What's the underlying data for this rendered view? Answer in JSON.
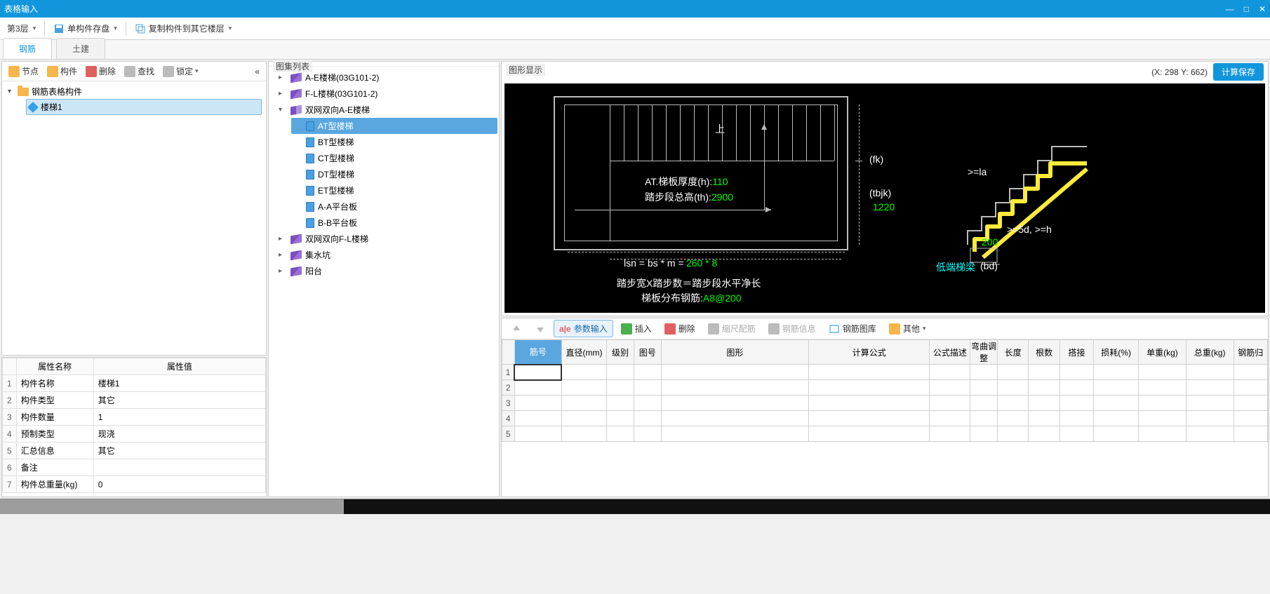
{
  "window": {
    "title": "表格输入"
  },
  "toolbar": {
    "floor_label": "第3层",
    "save_single": "单构件存盘",
    "copy_to_floors": "复制构件到其它楼层"
  },
  "tabs": {
    "rebar": "钢筋",
    "civil": "土建"
  },
  "left_toolbar": {
    "node": "节点",
    "component": "构件",
    "delete": "删除",
    "find": "查找",
    "lock": "锁定"
  },
  "tree": {
    "root": "钢筋表格构件",
    "items": [
      "楼梯1"
    ]
  },
  "properties": {
    "header_name": "属性名称",
    "header_value": "属性值",
    "rows": [
      {
        "n": "1",
        "name": "构件名称",
        "value": "楼梯1"
      },
      {
        "n": "2",
        "name": "构件类型",
        "value": "其它"
      },
      {
        "n": "3",
        "name": "构件数量",
        "value": "1"
      },
      {
        "n": "4",
        "name": "预制类型",
        "value": "现浇"
      },
      {
        "n": "5",
        "name": "汇总信息",
        "value": "其它"
      },
      {
        "n": "6",
        "name": "备注",
        "value": ""
      },
      {
        "n": "7",
        "name": "构件总重量(kg)",
        "value": "0"
      }
    ]
  },
  "atlas": {
    "title": "图集列表",
    "items": [
      {
        "label": "A-E楼梯(03G101-2)",
        "expandable": true
      },
      {
        "label": "F-L楼梯(03G101-2)",
        "expandable": true
      },
      {
        "label": "双网双向A-E楼梯",
        "expandable": true,
        "expanded": true,
        "children": [
          "AT型楼梯",
          "BT型楼梯",
          "CT型楼梯",
          "DT型楼梯",
          "ET型楼梯",
          "A-A平台板",
          "B-B平台板"
        ]
      },
      {
        "label": "双网双向F-L楼梯",
        "expandable": true
      },
      {
        "label": "集水坑",
        "expandable": true
      },
      {
        "label": "阳台",
        "expandable": true
      }
    ],
    "selected_child": "AT型楼梯"
  },
  "figure": {
    "title": "图形显示",
    "coord_label": "(X: 298 Y: 662)",
    "save_label": "计算保存",
    "labels": {
      "at_thickness_text": "AT.梯板厚度(h):",
      "at_thickness_val": "110",
      "step_total_h_text": "踏步段总高(th):",
      "step_total_h_val": "2900",
      "lsn_formula_text": "lsn = bs * m =",
      "lsn_formula_val": "260 * 8",
      "bottom1": "踏步宽X踏步数＝踏步段水平净长",
      "bottom2_text": "梯板分布钢筋:",
      "bottom2_val": "A8@200",
      "fk": "(fk)",
      "tbjk": "(tbjk)",
      "tbjk_val": "1220",
      "ge_la": ">=la",
      "ge_5d": ">=5d, >=h",
      "two_hundred": "200",
      "low_beam": "低端梯梁",
      "low_beam_suffix": "(bd)",
      "up_marker": "上"
    }
  },
  "grid_toolbar": {
    "param_input": "参数输入",
    "insert": "插入",
    "delete": "删除",
    "scale_rebar": "缩尺配筋",
    "rebar_info": "钢筋信息",
    "rebar_lib": "钢筋图库",
    "other": "其他"
  },
  "grid": {
    "columns": [
      "筋号",
      "直径(mm)",
      "级别",
      "图号",
      "图形",
      "计算公式",
      "公式描述",
      "弯曲调整",
      "长度",
      "根数",
      "搭接",
      "损耗(%)",
      "单重(kg)",
      "总重(kg)",
      "钢筋归"
    ],
    "row_count": 5
  }
}
